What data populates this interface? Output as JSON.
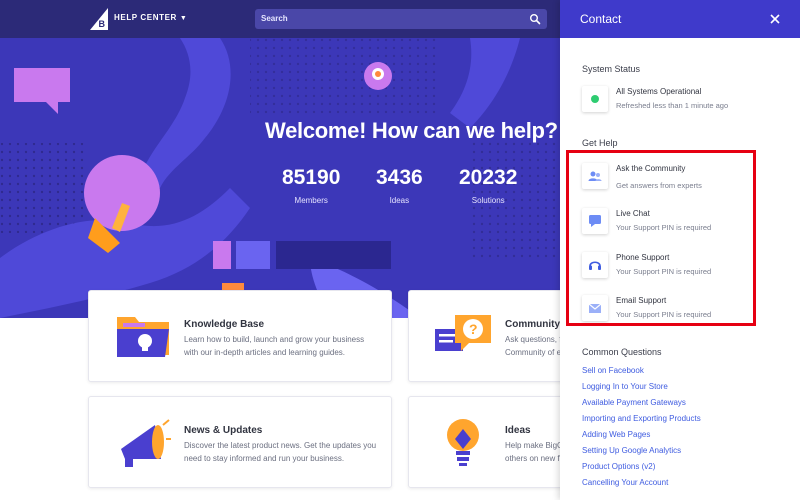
{
  "header": {
    "brand": "HELP CENTER",
    "search_placeholder": "Search"
  },
  "hero": {
    "title": "Welcome! How can we help?",
    "stats": [
      {
        "value": "85190",
        "label": "Members"
      },
      {
        "value": "3436",
        "label": "Ideas"
      },
      {
        "value": "20232",
        "label": "Solutions"
      }
    ]
  },
  "cards": [
    {
      "title": "Knowledge Base",
      "desc_line1": "Learn how to build, launch and grow your business",
      "desc_line2": "with our in-depth articles and learning guides."
    },
    {
      "title": "Community",
      "desc_line1": "Ask questions, fi",
      "desc_line2": "Community of ex"
    },
    {
      "title": "News & Updates",
      "desc_line1": "Discover the latest product news. Get the updates you",
      "desc_line2": "need to stay informed and run your business."
    },
    {
      "title": "Ideas",
      "desc_line1": "Help make BigC",
      "desc_line2": "others on new fe"
    }
  ],
  "panel": {
    "title": "Contact",
    "system_status_heading": "System Status",
    "status": {
      "title": "All Systems Operational",
      "sub": "Refreshed less than 1 minute ago"
    },
    "get_help_heading": "Get Help",
    "help_items": [
      {
        "title": "Ask the Community",
        "sub": "Get answers from experts",
        "icon": "users-icon"
      },
      {
        "title": "Live Chat",
        "sub": "Your Support PIN is required",
        "icon": "chat-icon"
      },
      {
        "title": "Phone Support",
        "sub": "Your Support PIN is required",
        "icon": "headset-icon"
      },
      {
        "title": "Email Support",
        "sub": "Your Support PIN is required",
        "icon": "envelope-icon"
      }
    ],
    "common_heading": "Common Questions",
    "questions": [
      "Sell on Facebook",
      "Logging In to Your Store",
      "Available Payment Gateways",
      "Importing and Exporting Products",
      "Adding Web Pages",
      "Setting Up Google Analytics",
      "Product Options (v2)",
      "Cancelling Your Account"
    ]
  },
  "colors": {
    "topbar": "#2c2a78",
    "hero": "#3c37b8",
    "panel_header": "#3f3acb",
    "link": "#3f5ce0",
    "status_ok": "#2ecc71",
    "highlight": "#e60012"
  }
}
